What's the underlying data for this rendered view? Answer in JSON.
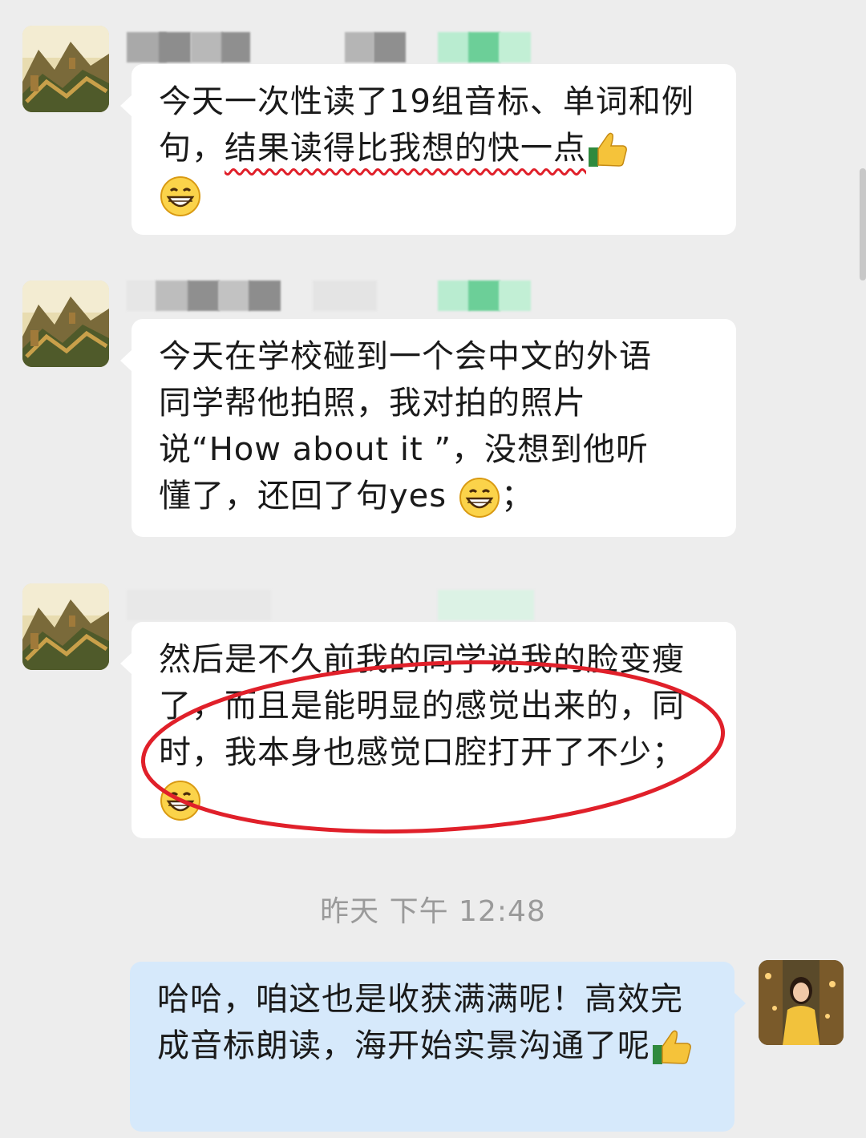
{
  "messages": [
    {
      "text_before": "今天一次性读了19组音标、单词和例句，",
      "text_highlight": "结果读得比我想的快一点",
      "emojis": [
        "thumbs-up",
        "grin"
      ]
    },
    {
      "text": "今天在学校碰到一个会中文的外语同学帮他拍照，我对拍的照片说“How about it ”，没想到他听懂了，还回了句yes",
      "text_after": "；",
      "emojis": [
        "grin"
      ]
    },
    {
      "text": "然后是不久前我的同学说我的脸变瘦了，而且是能明显的感觉出来的，同时，我本身也感觉口腔打开了不少；",
      "emojis": [
        "grin"
      ]
    }
  ],
  "timestamp": "昨天  下午 12:48",
  "reply": {
    "text": "哈哈，咱这也是收获满满呢！高效完成音标朗读，海开始实景沟通了呢",
    "emojis": [
      "thumbs-up"
    ]
  },
  "colors": {
    "annotation_red": "#e0202a",
    "self_bubble": "#d6e9fb",
    "background": "#ededed"
  }
}
